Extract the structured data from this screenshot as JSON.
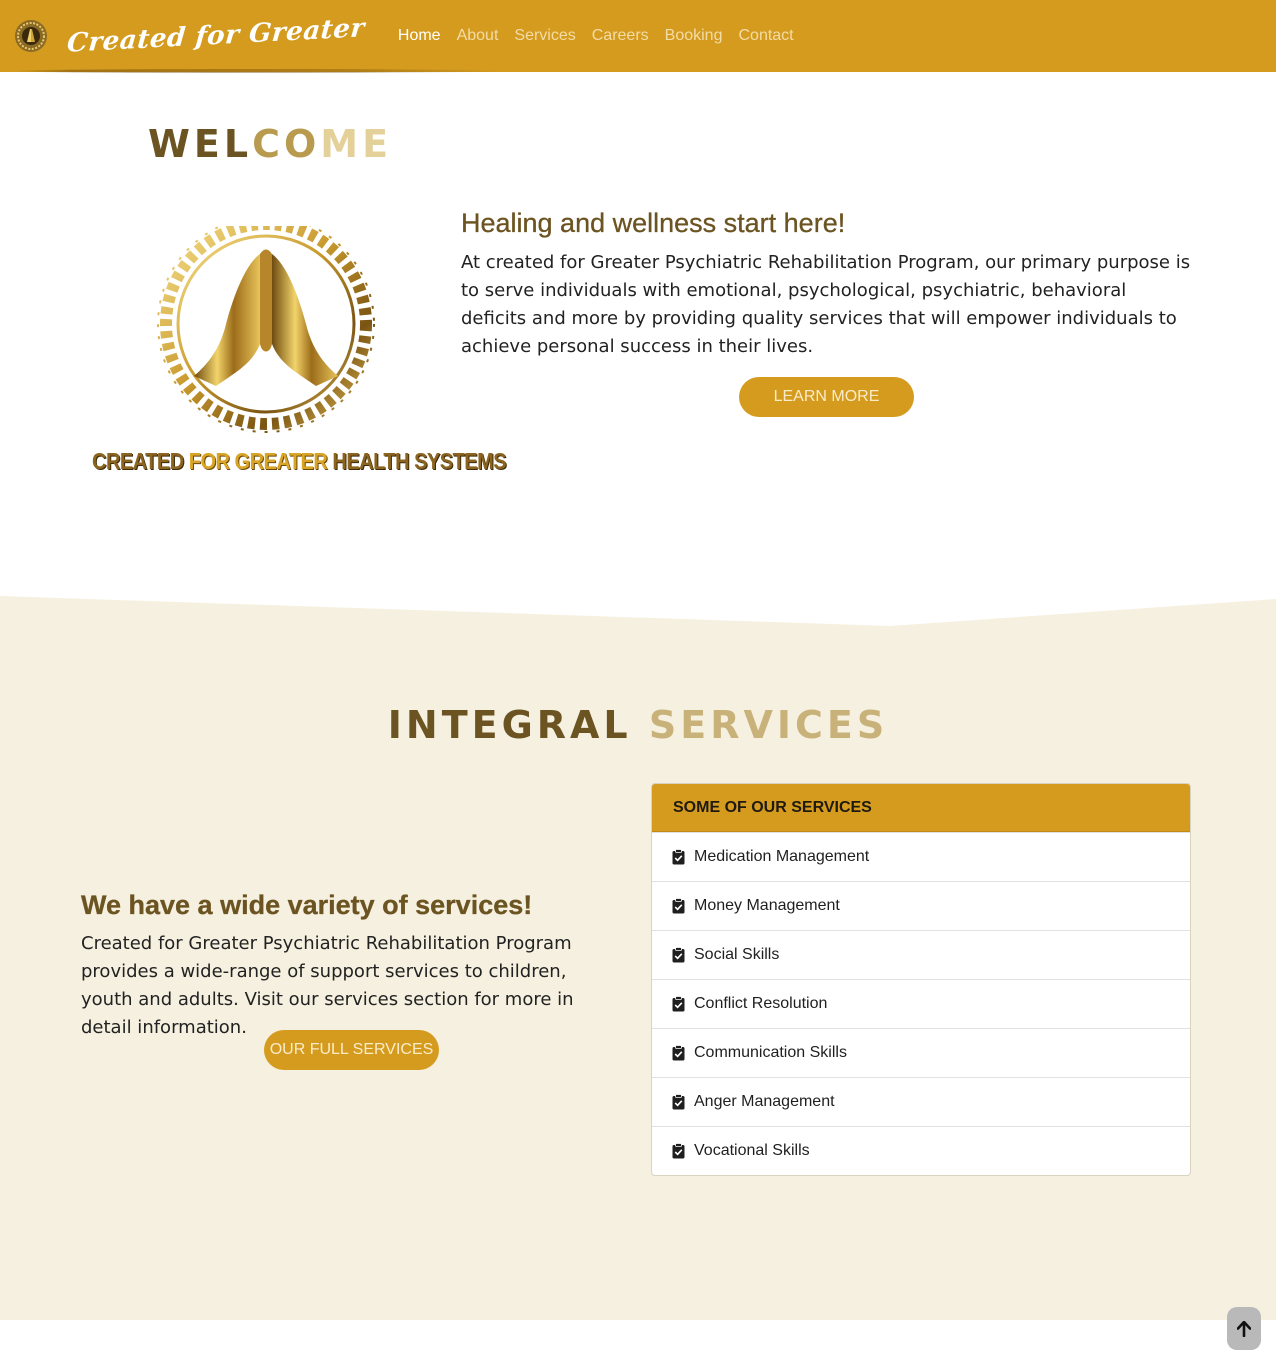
{
  "navbar": {
    "brand": "Created for Greater",
    "links": [
      "Home",
      "About",
      "Services",
      "Careers",
      "Booking",
      "Contact"
    ],
    "active": "Home",
    "logo_icon": "praying-hands-logo"
  },
  "welcome": {
    "title_part1": "WEL",
    "title_part2": "CO",
    "title_part3": "ME",
    "logo_caption_part1": "CREATED ",
    "logo_caption_part2": "FOR GREATER ",
    "logo_caption_part3": "HEALTH SYSTEMS",
    "heading": "Healing and wellness start here!",
    "text": "At created for Greater Psychiatric Rehabilitation Program, our primary purpose is to serve individuals with emotional, psychological, psychiatric, behavioral deficits and more by providing quality services that will empower individuals to achieve personal success in their lives.",
    "button": "LEARN MORE"
  },
  "services": {
    "title_word1": "INTEGRAL",
    "title_word2": "SERVICES",
    "heading": "We have a wide variety of services!",
    "text": "Created for Greater Psychiatric Rehabilitation Program provides a wide-range of support services to children, youth and adults. Visit our services section for more in detail information.",
    "button": "OUR FULL SERVICES",
    "card_header": "SOME OF OUR SERVICES",
    "items": [
      "Medication Management",
      "Money Management",
      "Social Skills",
      "Conflict Resolution",
      "Communication Skills",
      "Anger Management",
      "Vocational Skills"
    ],
    "item_icon": "clipboard-check-icon"
  },
  "scroll_top_icon": "arrow-up-icon",
  "colors": {
    "gold": "#d49b1f",
    "brown": "#6b5421",
    "cream": "#f5f0df"
  }
}
